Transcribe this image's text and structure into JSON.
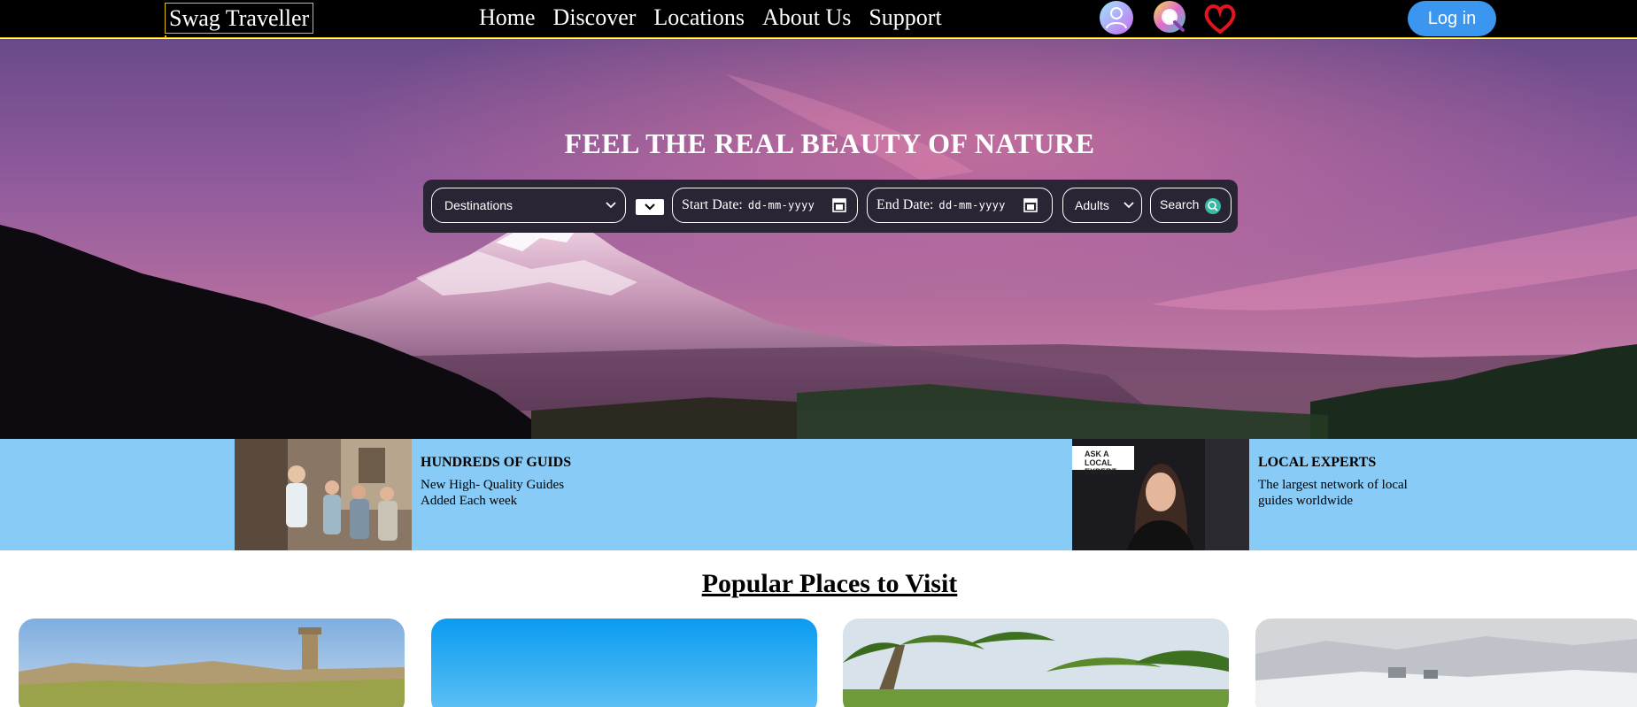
{
  "nav": {
    "brand": "Swag Traveller",
    "links": [
      "Home",
      "Discover",
      "Locations",
      "About Us",
      "Support"
    ],
    "icons": [
      "user-icon",
      "search-icon",
      "heart-icon"
    ],
    "login_label": "Log in",
    "accent_color": "#e5c100",
    "login_color": "#3a96ef"
  },
  "hero": {
    "title": "FEEL THE REAL BEAUTY OF NATURE",
    "search": {
      "destination_value": "Destinations",
      "start_label": "Start Date:",
      "start_value": "dd-mm-yyyy",
      "end_label": "End Date:",
      "end_value": "dd-mm-yyyy",
      "adults_value": "Adults",
      "search_label": "Search"
    }
  },
  "features": [
    {
      "title": "HUNDREDS OF GUIDS",
      "description": "New High- Quality Guides Added Each week"
    },
    {
      "badge": "ASK A LOCAL EXPERT",
      "title": "LOCAL EXPERTS",
      "description": "The largest network of local guides worldwide"
    }
  ],
  "popular": {
    "title": "Popular Places to Visit",
    "cards": [
      "fort-image",
      "beach-sky-image",
      "palm-trees-image",
      "snow-village-image"
    ]
  },
  "colors": {
    "strip_background": "#87cbf6",
    "search_bar_background": "#2a2534"
  }
}
